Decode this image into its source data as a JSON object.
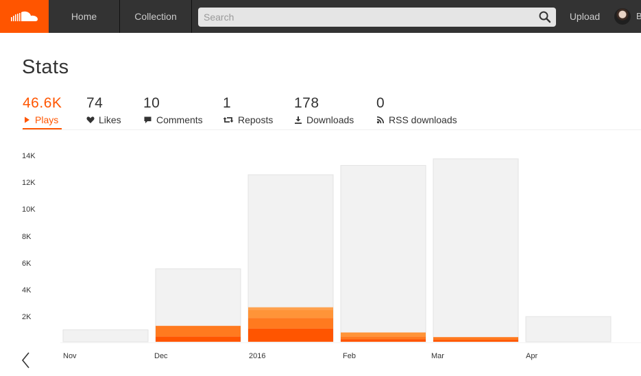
{
  "header": {
    "nav": [
      {
        "label": "Home"
      },
      {
        "label": "Collection"
      }
    ],
    "search_placeholder": "Search",
    "upload_label": "Upload",
    "user_initial": "B"
  },
  "page": {
    "title": "Stats"
  },
  "stats": [
    {
      "value": "46.6K",
      "label": "Plays",
      "icon": "play-icon",
      "active": true
    },
    {
      "value": "74",
      "label": "Likes",
      "icon": "heart-icon"
    },
    {
      "value": "10",
      "label": "Comments",
      "icon": "comment-icon"
    },
    {
      "value": "1",
      "label": "Reposts",
      "icon": "repost-icon"
    },
    {
      "value": "178",
      "label": "Downloads",
      "icon": "download-icon"
    },
    {
      "value": "0",
      "label": "RSS downloads",
      "icon": "rss-icon"
    }
  ],
  "colors": {
    "brand": "#ff5500",
    "topbar": "#333333",
    "bar_total": "#f2f2f2",
    "stack": [
      "#ff5500",
      "#ff7a1f",
      "#ff9438",
      "#ffa14d",
      "#ffb35f"
    ]
  },
  "chart_data": {
    "type": "bar",
    "stacked": true,
    "categories": [
      "Nov",
      "Dec",
      "2016",
      "Feb",
      "Mar",
      "Apr"
    ],
    "y_ticks": [
      "2K",
      "4K",
      "6K",
      "8K",
      "10K",
      "12K",
      "14K"
    ],
    "ylim": [
      0,
      14000
    ],
    "grid": false,
    "legend": "none",
    "totals": [
      900,
      5500,
      12600,
      13300,
      13800,
      1900
    ],
    "highlighted_segments": [
      [],
      [
        400,
        800
      ],
      [
        1000,
        800,
        600,
        200
      ],
      [
        200,
        200,
        300
      ],
      [
        150,
        200
      ],
      []
    ]
  }
}
